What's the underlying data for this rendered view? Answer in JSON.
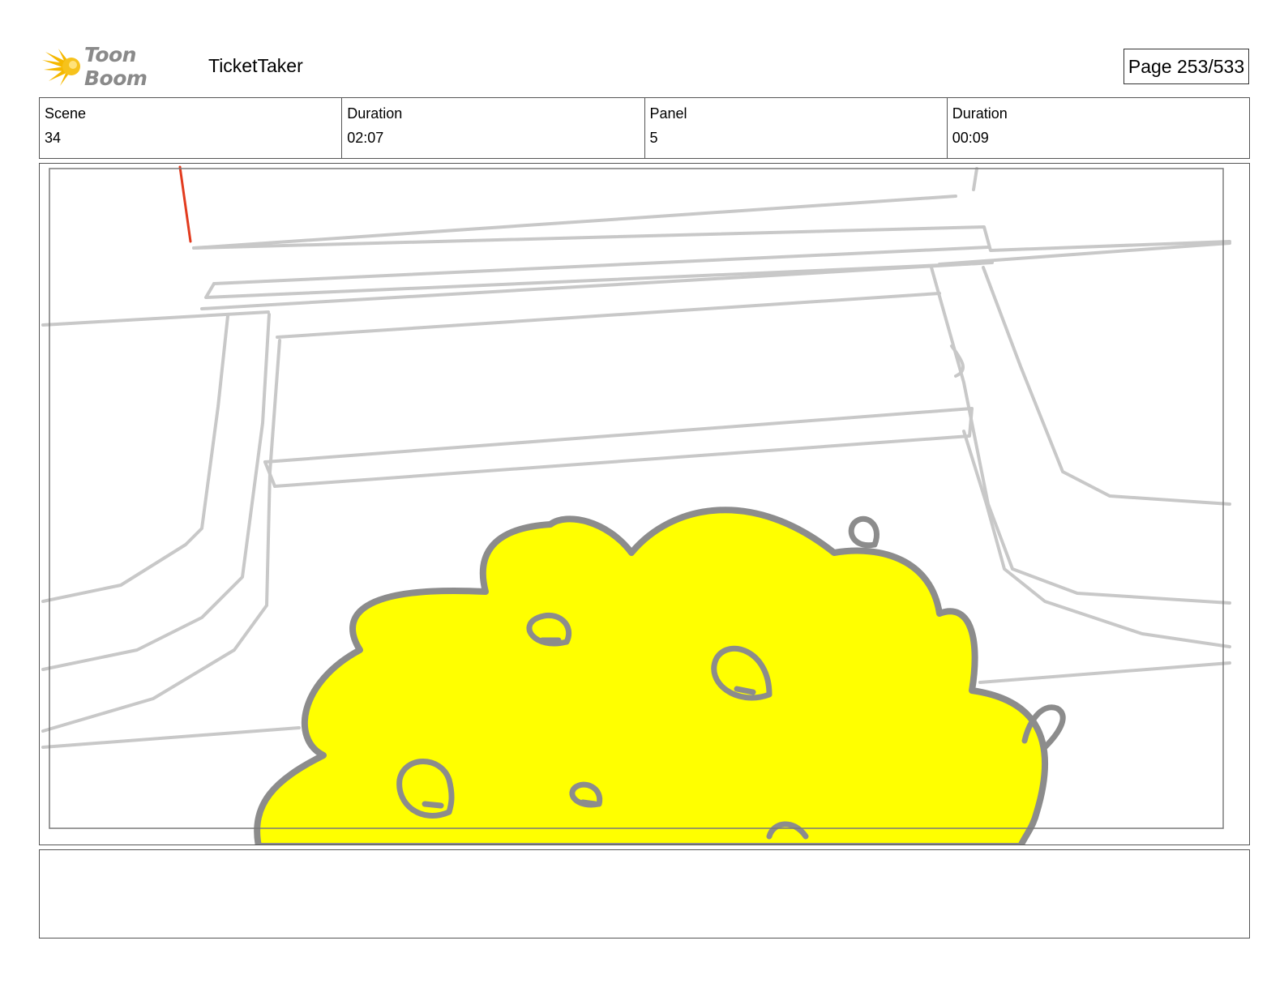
{
  "header": {
    "logo_text": "Toon Boom",
    "project_title": "TicketTaker",
    "page_label": "Page 253/533"
  },
  "info": [
    {
      "label": "Scene",
      "value": "34"
    },
    {
      "label": "Duration",
      "value": "02:07"
    },
    {
      "label": "Panel",
      "value": "5"
    },
    {
      "label": "Duration",
      "value": "00:09"
    }
  ],
  "panel": {
    "sketch_line_color": "#c8c8c8",
    "cloud_fill_color": "#ffff00",
    "cloud_outline_color": "#8c8c8c",
    "accent_line_color": "#e23b1e"
  },
  "notes": {
    "text": ""
  }
}
